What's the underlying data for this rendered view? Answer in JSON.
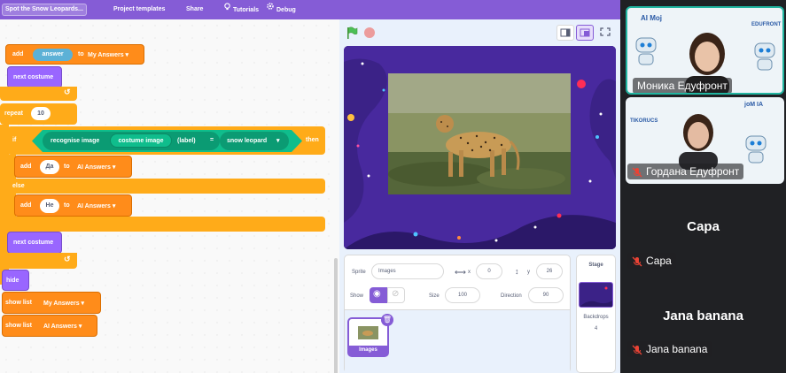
{
  "menubar": {
    "project_title": "Spot the Snow Leopards...",
    "project_templates": "Project templates",
    "share": "Share",
    "tutorials": "Tutorials",
    "debug": "Debug"
  },
  "scripts": {
    "add_answer": {
      "add": "add",
      "value": "answer",
      "to": "to",
      "list": "My Answers"
    },
    "next_costume_1": "next costume",
    "repeat": {
      "label": "repeat",
      "count": "10"
    },
    "if_block": {
      "if": "if",
      "recognise_image": "recognise image",
      "costume_image": "costume image",
      "label": "(label)",
      "equals": "=",
      "snow_leopard": "snow leopard",
      "then": "then"
    },
    "add_da": {
      "add": "add",
      "value": "Да",
      "to": "to",
      "list": "AI Answers"
    },
    "else": "else",
    "add_ne": {
      "add": "add",
      "value": "Не",
      "to": "to",
      "list": "AI Answers"
    },
    "next_costume_2": "next costume",
    "hide": "hide",
    "show_list_1": {
      "label": "show list",
      "list": "My Answers"
    },
    "show_list_2": {
      "label": "show list",
      "list": "AI Answers"
    }
  },
  "sprite_info": {
    "sprite_label": "Sprite",
    "sprite_name": "Images",
    "x_label": "x",
    "x_value": "0",
    "y_label": "y",
    "y_value": "26",
    "show_label": "Show",
    "size_label": "Size",
    "size_value": "100",
    "direction_label": "Direction",
    "direction_value": "90"
  },
  "sprite_list": {
    "thumb_label": "Images"
  },
  "stage_pane": {
    "title": "Stage",
    "backdrops_label": "Backdrops",
    "backdrops_count": "4"
  },
  "video": {
    "participants": [
      {
        "name": "Моника Едуфронт",
        "logo_left": "AI Moj",
        "logo_right": "EDUFRONT"
      },
      {
        "name": "Гордана Едуфронт",
        "logo_left": "TIKORUCS",
        "logo_right": "joM IA"
      }
    ],
    "audio_only": [
      {
        "big": "Сара",
        "tag": "Сара"
      },
      {
        "big": "Jana banana",
        "tag": "Jana banana"
      }
    ]
  },
  "colors": {
    "menubar": "#855cd6",
    "events": "#ffab19",
    "lists": "#ff8c1a",
    "looks": "#9966ff",
    "ml": "#0fbd8c",
    "stage_bg": "#35207a"
  }
}
